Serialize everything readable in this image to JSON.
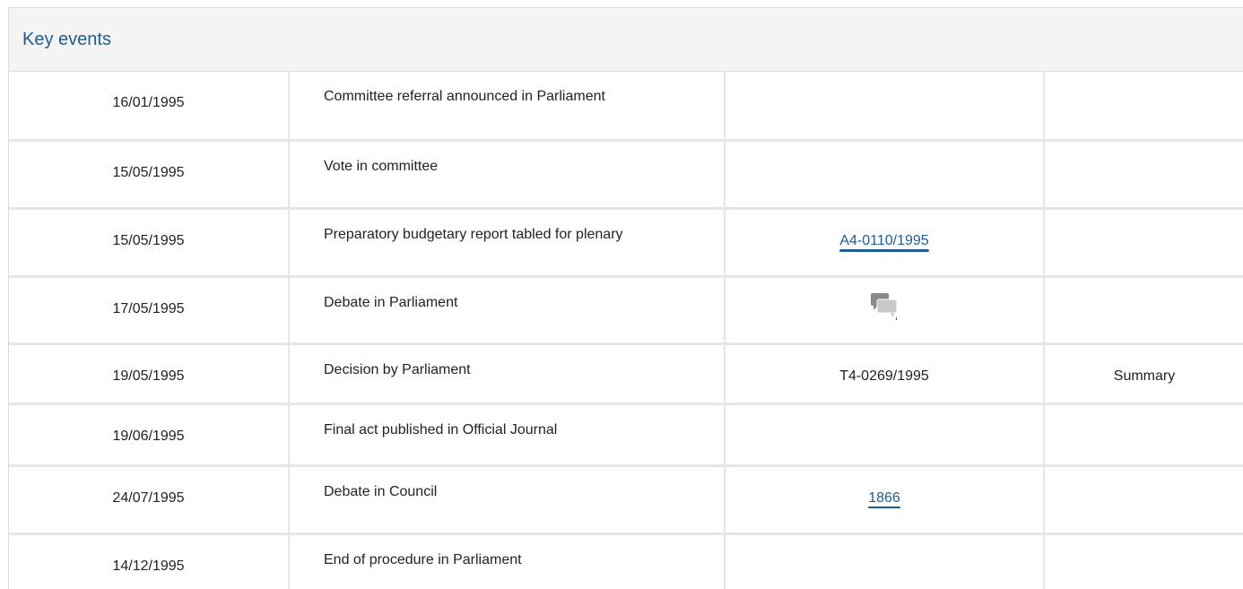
{
  "panel": {
    "title": "Key events"
  },
  "events": [
    {
      "date": "16/01/1995",
      "event": "Committee referral announced in Parliament",
      "reference": "",
      "summary": ""
    },
    {
      "date": "15/05/1995",
      "event": "Vote in committee",
      "reference": "",
      "summary": ""
    },
    {
      "date": "15/05/1995",
      "event": "Preparatory budgetary report tabled for plenary",
      "reference": "A4-0110/1995",
      "summary": ""
    },
    {
      "date": "17/05/1995",
      "event": "Debate in Parliament",
      "reference": "",
      "summary": ""
    },
    {
      "date": "19/05/1995",
      "event": "Decision by Parliament",
      "reference": "T4-0269/1995",
      "summary": "Summary"
    },
    {
      "date": "19/06/1995",
      "event": "Final act published in Official Journal",
      "reference": "",
      "summary": ""
    },
    {
      "date": "24/07/1995",
      "event": "Debate in Council",
      "reference": "1866",
      "summary": ""
    },
    {
      "date": "14/12/1995",
      "event": "End of procedure in Parliament",
      "reference": "",
      "summary": ""
    }
  ],
  "icons": {
    "debate": "debate-speech-bubbles-icon"
  },
  "colors": {
    "link": "#1f5b94",
    "header_bg": "#f4f4f4",
    "border": "#e6e6e6"
  }
}
